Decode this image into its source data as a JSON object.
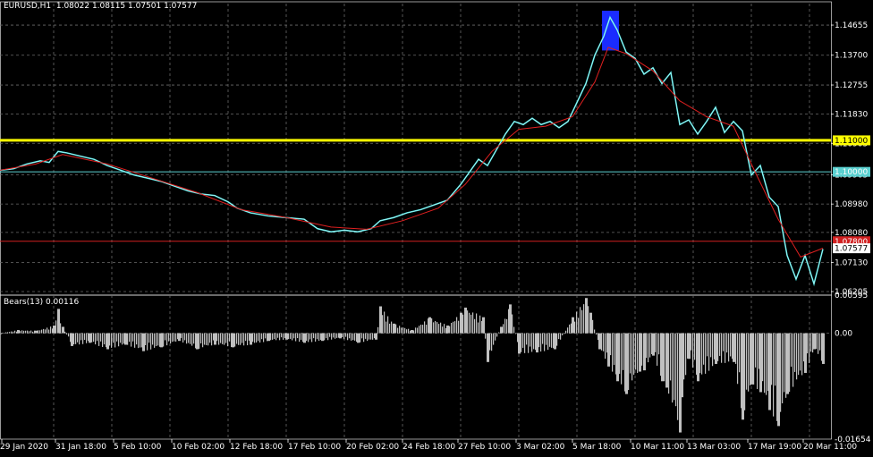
{
  "header": {
    "symbol": "EURUSD,H1",
    "ohlc": "1.08022 1.08115 1.07501 1.07577"
  },
  "indicator": {
    "label": "Bears(13) 0.00116"
  },
  "colors": {
    "background": "#000000",
    "grid": "#6b6b6b",
    "price_line": "#40e0e0",
    "moving_average": "#e02020",
    "yellow_line": "#ffff00",
    "cyan_line": "#5ad0d0",
    "red_line": "#d02020",
    "histogram": "#c0c0c0",
    "highlight": "#1a2cff",
    "axis_text": "#ffffff"
  },
  "price_axis": {
    "ticks": [
      "1.14655",
      "1.13700",
      "1.12755",
      "1.11830",
      "1.10905",
      "1.09905",
      "1.08980",
      "1.08080",
      "1.07130",
      "1.06205"
    ],
    "tick_values": [
      1.14655,
      1.137,
      1.12755,
      1.1183,
      1.10905,
      1.09905,
      1.0898,
      1.0808,
      1.0713,
      1.06205
    ],
    "range": [
      1.06205,
      1.1511
    ]
  },
  "levels": [
    {
      "name": "yellow-level",
      "label": "1.11000",
      "value": 1.11,
      "color": "#ffff00",
      "text_color": "#000000"
    },
    {
      "name": "cyan-level",
      "label": "1.10000",
      "value": 1.1,
      "color": "#5ad0d0",
      "text_color": "#ffffff"
    },
    {
      "name": "red-level",
      "label": "1.07800",
      "value": 1.078,
      "color": "#d02020",
      "text_color": "#ffffff"
    },
    {
      "name": "current-price",
      "label": "1.07577",
      "value": 1.07577,
      "color": "#ffffff",
      "text_color": "#000000"
    }
  ],
  "indicator_axis": {
    "ticks": [
      "0.00595",
      "0.00",
      "-0.01654"
    ],
    "tick_values": [
      0.00595,
      0,
      -0.01654
    ]
  },
  "time_axis": {
    "labels": [
      "29 Jan 2020",
      "31 Jan 18:00",
      "5 Feb 10:00",
      "10 Feb 02:00",
      "12 Feb 18:00",
      "17 Feb 10:00",
      "20 Feb 02:00",
      "24 Feb 18:00",
      "27 Feb 10:00",
      "3 Mar 02:00",
      "5 Mar 18:00",
      "10 Mar 11:00",
      "13 Mar 03:00",
      "17 Mar 19:00",
      "20 Mar 11:00"
    ]
  },
  "chart_data": {
    "type": "line",
    "series": [
      {
        "name": "EURUSD,H1",
        "x": [
          0,
          15,
          30,
          45,
          55,
          65,
          75,
          90,
          105,
          120,
          135,
          150,
          165,
          180,
          195,
          210,
          225,
          240,
          255,
          265,
          280,
          300,
          320,
          340,
          355,
          370,
          385,
          400,
          415,
          425,
          440,
          455,
          470,
          485,
          500,
          515,
          525,
          535,
          545,
          555,
          565,
          575,
          585,
          595,
          605,
          615,
          625,
          635,
          645,
          655,
          665,
          675,
          682,
          690,
          700,
          710,
          720,
          730,
          740,
          750,
          760,
          770,
          780,
          790,
          800,
          810,
          820,
          830,
          840,
          850,
          860,
          870,
          880,
          890,
          900,
          910,
          920
        ],
        "values": [
          1.1005,
          1.101,
          1.1025,
          1.1035,
          1.103,
          1.1065,
          1.106,
          1.105,
          1.104,
          1.102,
          1.1005,
          1.099,
          1.098,
          1.097,
          1.0955,
          1.094,
          1.093,
          1.0925,
          1.0905,
          1.0885,
          1.087,
          1.086,
          1.0855,
          1.085,
          1.082,
          1.081,
          1.0815,
          1.081,
          1.082,
          1.0845,
          1.0855,
          1.087,
          1.088,
          1.0895,
          1.091,
          1.096,
          1.1,
          1.104,
          1.102,
          1.107,
          1.112,
          1.116,
          1.115,
          1.117,
          1.115,
          1.116,
          1.114,
          1.116,
          1.122,
          1.128,
          1.137,
          1.143,
          1.149,
          1.145,
          1.138,
          1.136,
          1.131,
          1.133,
          1.128,
          1.1315,
          1.115,
          1.1165,
          1.112,
          1.116,
          1.1205,
          1.1125,
          1.116,
          1.113,
          1.099,
          1.102,
          1.092,
          1.089,
          1.0735,
          1.066,
          1.0735,
          1.0645,
          1.0755
        ]
      },
      {
        "name": "MA",
        "x": [
          0,
          40,
          70,
          120,
          170,
          220,
          270,
          320,
          370,
          410,
          450,
          490,
          520,
          550,
          580,
          610,
          640,
          665,
          680,
          700,
          730,
          760,
          790,
          820,
          845,
          870,
          895,
          920
        ],
        "values": [
          1.1005,
          1.1025,
          1.1055,
          1.1025,
          1.098,
          1.0935,
          1.088,
          1.0855,
          1.0825,
          1.0818,
          1.0845,
          1.0885,
          1.096,
          1.1065,
          1.1135,
          1.1145,
          1.1175,
          1.1285,
          1.1395,
          1.1375,
          1.132,
          1.1225,
          1.1175,
          1.1145,
          1.0995,
          1.085,
          1.073,
          1.0758
        ]
      }
    ],
    "indicator": {
      "name": "Bears(13)",
      "range": [
        -0.01654,
        0.00595
      ],
      "x": [
        0,
        20,
        40,
        60,
        65,
        70,
        80,
        100,
        120,
        140,
        160,
        180,
        200,
        220,
        240,
        260,
        280,
        300,
        320,
        340,
        360,
        380,
        400,
        420,
        425,
        440,
        460,
        480,
        500,
        515,
        520,
        540,
        545,
        560,
        570,
        580,
        600,
        620,
        640,
        655,
        660,
        670,
        680,
        690,
        700,
        715,
        720,
        730,
        740,
        745,
        760,
        762,
        770,
        780,
        800,
        820,
        830,
        840,
        850,
        860,
        870,
        880,
        900,
        910,
        920
      ],
      "values": [
        0.0,
        0.0005,
        0.0004,
        0.0012,
        0.0038,
        0.001,
        -0.002,
        -0.0015,
        -0.0025,
        -0.0018,
        -0.0028,
        -0.0022,
        -0.0012,
        -0.0025,
        -0.0018,
        -0.0022,
        -0.0018,
        -0.0012,
        -0.001,
        -0.0015,
        -0.0012,
        -0.0008,
        -0.0015,
        -0.001,
        0.0042,
        0.0015,
        0.0005,
        0.0025,
        0.0012,
        0.0032,
        0.004,
        0.0025,
        -0.0045,
        0.001,
        0.0045,
        -0.0032,
        -0.003,
        -0.0025,
        0.0025,
        0.0055,
        0.0032,
        -0.0025,
        -0.0052,
        -0.0075,
        -0.0095,
        -0.006,
        -0.0058,
        -0.0035,
        -0.0075,
        -0.0085,
        -0.0155,
        -0.01,
        -0.004,
        -0.0075,
        -0.0048,
        -0.0045,
        -0.0135,
        -0.008,
        -0.0092,
        -0.012,
        -0.0145,
        -0.0095,
        -0.0062,
        -0.0025,
        -0.0048
      ]
    },
    "highlight_region": {
      "x_from": 673,
      "x_to": 692,
      "y_from": 1.1511,
      "y_to": 1.1385
    },
    "ylim": [
      1.06205,
      1.1511
    ],
    "grid": true
  }
}
